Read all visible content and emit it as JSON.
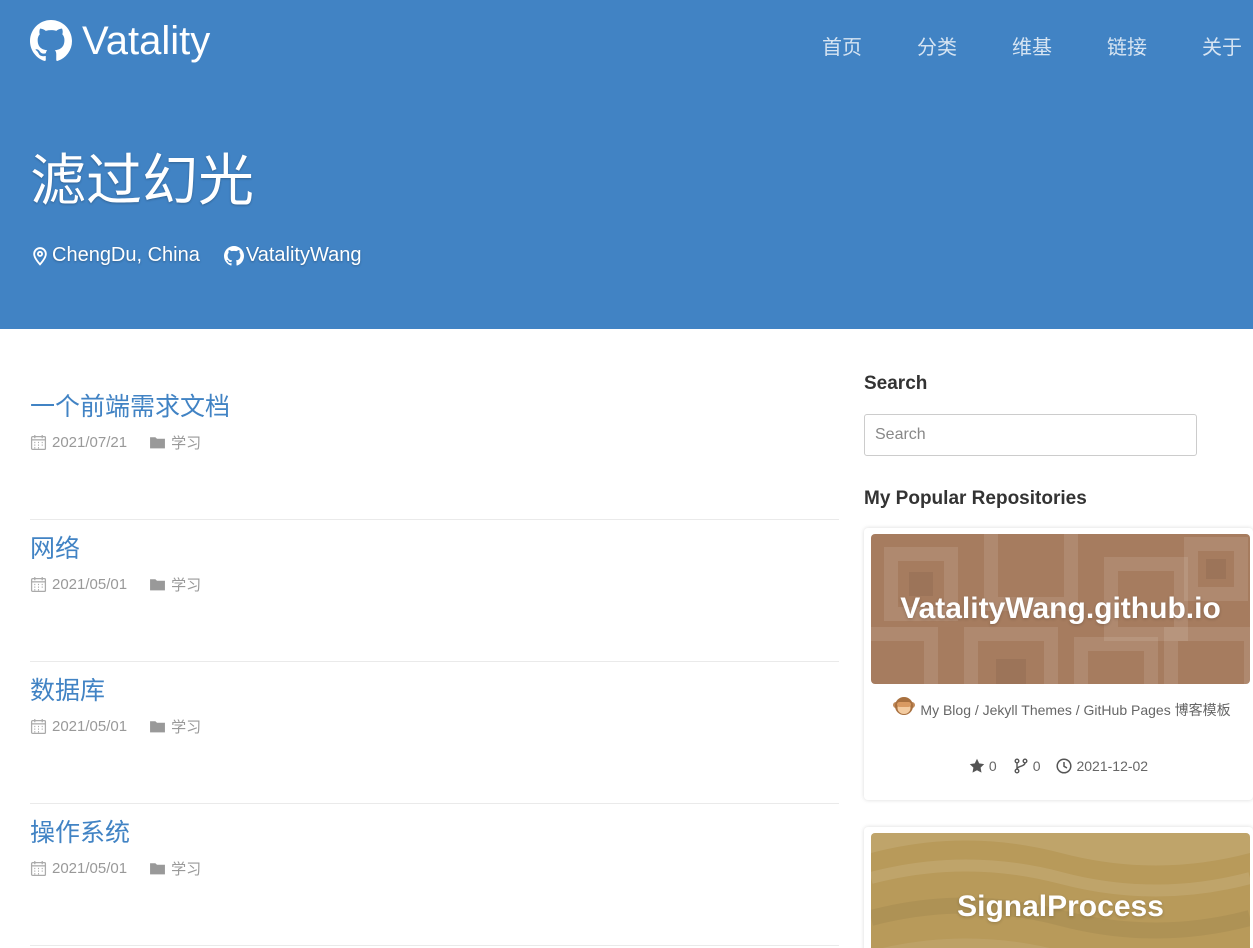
{
  "header": {
    "brand": "Vatality",
    "nav": [
      "首页",
      "分类",
      "维基",
      "链接",
      "关于"
    ],
    "title": "滤过幻光",
    "location": "ChengDu, China",
    "github_user": "VatalityWang"
  },
  "posts": [
    {
      "title": "一个前端需求文档",
      "date": "2021/07/21",
      "category": "学习"
    },
    {
      "title": "网络",
      "date": "2021/05/01",
      "category": "学习"
    },
    {
      "title": "数据库",
      "date": "2021/05/01",
      "category": "学习"
    },
    {
      "title": "操作系统",
      "date": "2021/05/01",
      "category": "学习"
    }
  ],
  "sidebar": {
    "search_title": "Search",
    "search_placeholder": "Search",
    "repos_title": "My Popular Repositories",
    "repos": [
      {
        "name": "VatalityWang.github.io",
        "description": "My Blog / Jekyll Themes / GitHub Pages 博客模板",
        "stars": "0",
        "forks": "0",
        "updated": "2021-12-02",
        "cover_color": "#a67c5f"
      },
      {
        "name": "SignalProcess",
        "cover_color": "#b89a5a"
      }
    ]
  },
  "colors": {
    "accent": "#4183c4",
    "meta_gray": "#999999"
  }
}
